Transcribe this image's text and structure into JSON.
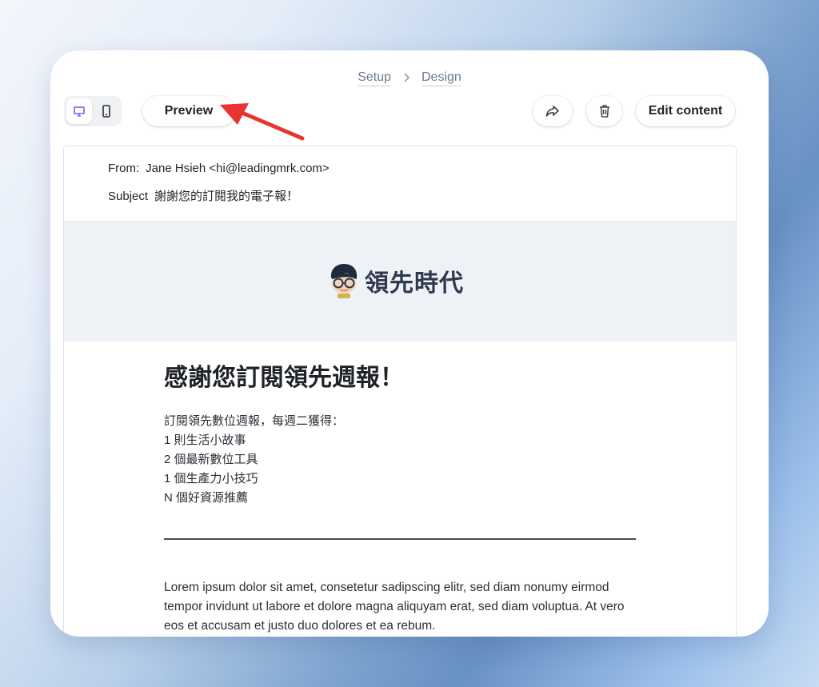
{
  "breadcrumb": {
    "items": [
      "Setup",
      "Design"
    ]
  },
  "toolbar": {
    "preview_label": "Preview",
    "edit_label": "Edit content",
    "device_icons": [
      "desktop-icon",
      "mobile-icon"
    ],
    "share_icon": "share-icon",
    "trash_icon": "trash-icon",
    "accent_color": "#6c63ff"
  },
  "annotation": {
    "arrow_color": "#e8332e"
  },
  "email": {
    "from_label": "From:",
    "from_value": "Jane Hsieh <hi@leadingmrk.com>",
    "subject_label": "Subject",
    "subject_value": "謝謝您的訂閱我的電子報！",
    "banner": {
      "logo_text": "領先時代",
      "background": "#eef1f5"
    },
    "headline": "感謝您訂閱領先週報！",
    "intro_lines": [
      "訂閱領先數位週報，每週二獲得：",
      "1 則生活小故事",
      "2 個最新數位工具",
      "1 個生產力小技巧",
      "N 個好資源推薦"
    ],
    "body": "Lorem ipsum dolor sit amet, consetetur sadipscing elitr, sed diam nonumy eirmod tempor invidunt ut labore et dolore magna aliquyam erat, sed diam voluptua. At vero eos et accusam et justo duo dolores et ea rebum."
  }
}
